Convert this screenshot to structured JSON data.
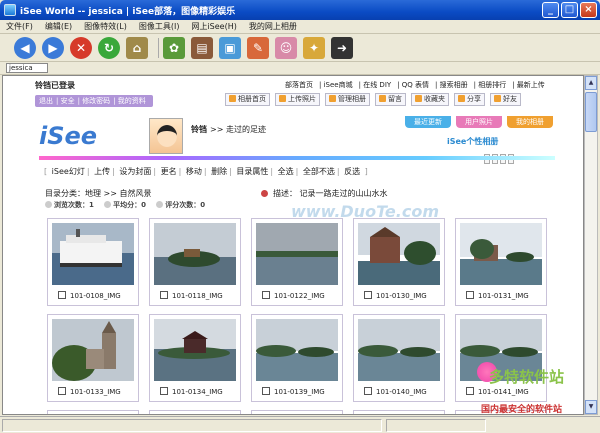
{
  "window": {
    "title": "iSee World -- jessica | iSee部落，图像精彩娱乐",
    "minimize": "_",
    "maximize": "□",
    "close": "×"
  },
  "menu": [
    "文件(F)",
    "编辑(E)",
    "图像特效(L)",
    "图像工具(I)",
    "网上iSee(H)",
    "我的网上相册"
  ],
  "toolbar": [
    {
      "icon": "back-icon",
      "color": "#3a7ad8"
    },
    {
      "icon": "forward-icon",
      "color": "#3a7ad8"
    },
    {
      "icon": "stop-icon",
      "color": "#d63a2a"
    },
    {
      "icon": "refresh-icon",
      "color": "#3aa83a"
    },
    {
      "icon": "home-icon",
      "color": "#7a6a3a"
    },
    {
      "icon": "frog-icon",
      "color": "#4a8a3a"
    },
    {
      "icon": "film-icon",
      "color": "#8a5a3a"
    },
    {
      "icon": "picture-icon",
      "color": "#4a9ad8"
    },
    {
      "icon": "brush-icon",
      "color": "#d8683a"
    },
    {
      "icon": "portrait-icon",
      "color": "#d88aa8"
    },
    {
      "icon": "puzzle-icon",
      "color": "#d8a83a"
    },
    {
      "icon": "exit-icon",
      "color": "#222222"
    }
  ],
  "address": {
    "value": "jessica"
  },
  "page": {
    "user_status": "铃铛已登录",
    "quick_links": [
      "退出",
      "安全",
      "修改密码",
      "我的资料"
    ],
    "top_nav": [
      "部落首页",
      "iSee商城",
      "在线 DIY",
      "QQ 表情",
      "搜索相册",
      "相册排行",
      "最新上传"
    ],
    "nav_buttons": [
      "相册首页",
      "上传照片",
      "管理相册",
      "留言",
      "收藏夹",
      "分享",
      "好友"
    ],
    "banner": {
      "logo": "iSee",
      "user": "铃铛",
      "crumb": ">> 走过的足迹",
      "tabs": [
        "最近更新",
        "用户照片",
        "我的相册"
      ],
      "tab_colors": [
        "#4ab0e8",
        "#e87ab8",
        "#f0a030"
      ],
      "personal_album": "iSee个性相册"
    },
    "actions": [
      "iSee幻灯",
      "上传",
      "设为封面",
      "更名",
      "移动",
      "删除",
      "目录属性",
      "全选",
      "全部不选",
      "反选"
    ],
    "category_label": "目录分类：地理  >> 自然风景",
    "stats": [
      "浏览次数：1",
      "平均分：0",
      "评分次数：0"
    ],
    "description": "描述：   记录一路走过的山山水水",
    "watermark": "www.DuoTe.com"
  },
  "photos": [
    {
      "name": "101-0108_IMG",
      "scene": "boat"
    },
    {
      "name": "101-0118_IMG",
      "scene": "island"
    },
    {
      "name": "101-0122_IMG",
      "scene": "lake"
    },
    {
      "name": "101-0130_IMG",
      "scene": "castle"
    },
    {
      "name": "101-0131_IMG",
      "scene": "castle-far"
    },
    {
      "name": "101-0133_IMG",
      "scene": "castle-tower"
    },
    {
      "name": "101-0134_IMG",
      "scene": "house"
    },
    {
      "name": "101-0139_IMG",
      "scene": "treeline"
    },
    {
      "name": "101-0140_IMG",
      "scene": "treeline"
    },
    {
      "name": "101-0141_IMG",
      "scene": "treeline"
    }
  ],
  "site_watermark": {
    "big": "多特软件站",
    "small": "国内最安全的软件站",
    "domain": "DuoTe.com"
  }
}
